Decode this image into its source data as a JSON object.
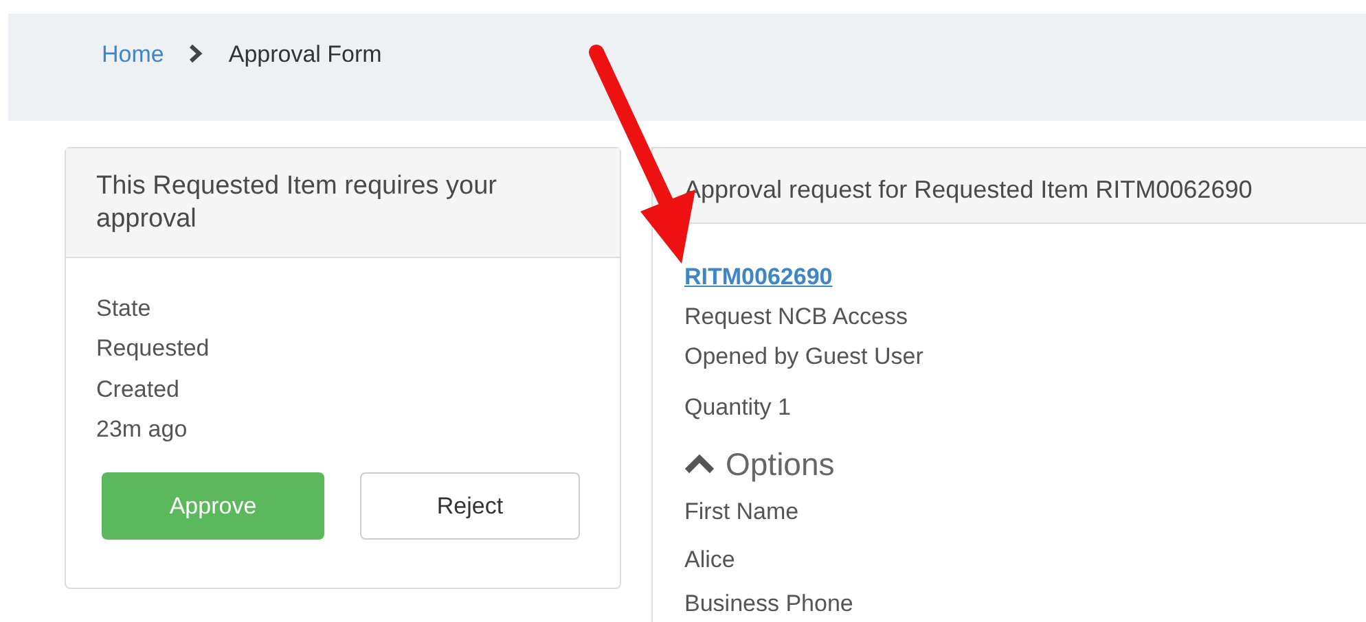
{
  "breadcrumb": [
    {
      "label": "Home",
      "kind": "link"
    },
    {
      "label": "Approval Form",
      "kind": "current"
    }
  ],
  "approval_card": {
    "title": "This Requested Item requires your approval",
    "fields": [
      {
        "label": "State",
        "value": "Requested"
      },
      {
        "label": "Created",
        "value": "23m ago"
      }
    ],
    "buttons": [
      {
        "label": "Approve",
        "kind": "primary"
      },
      {
        "label": "Reject",
        "kind": "secondary"
      }
    ]
  },
  "request_card": {
    "title": "Approval request for Requested Item RITM0062690",
    "number": "RITM0062690",
    "item": "Request NCB Access",
    "opened_by": "Opened by Guest User",
    "quantity": "Quantity 1",
    "options": {
      "title": "Options",
      "expanded": true,
      "fields": [
        {
          "label": "First Name",
          "value": "Alice"
        },
        {
          "label": "Business Phone"
        }
      ]
    }
  }
}
